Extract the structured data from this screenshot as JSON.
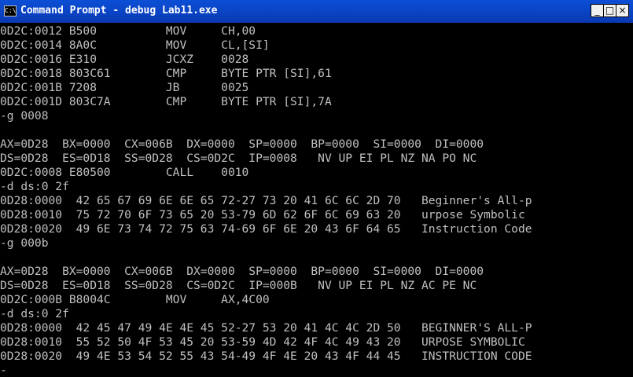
{
  "titlebar": {
    "icon_text": "C:\\",
    "title": "Command Prompt - debug Lab11.exe",
    "minimize_label": "_",
    "maximize_label": "□",
    "close_label": "×"
  },
  "console": {
    "lines": [
      "0D2C:0012 B500          MOV     CH,00",
      "0D2C:0014 8A0C          MOV     CL,[SI]",
      "0D2C:0016 E310          JCXZ    0028",
      "0D2C:0018 803C61        CMP     BYTE PTR [SI],61",
      "0D2C:001B 7208          JB      0025",
      "0D2C:001D 803C7A        CMP     BYTE PTR [SI],7A",
      "-g 0008",
      "",
      "AX=0D28  BX=0000  CX=006B  DX=0000  SP=0000  BP=0000  SI=0000  DI=0000",
      "DS=0D28  ES=0D18  SS=0D28  CS=0D2C  IP=0008   NV UP EI PL NZ NA PO NC",
      "0D2C:0008 E80500        CALL    0010",
      "-d ds:0 2f",
      "0D28:0000  42 65 67 69 6E 6E 65 72-27 73 20 41 6C 6C 2D 70   Beginner's All-p",
      "0D28:0010  75 72 70 6F 73 65 20 53-79 6D 62 6F 6C 69 63 20   urpose Symbolic",
      "0D28:0020  49 6E 73 74 72 75 63 74-69 6F 6E 20 43 6F 64 65   Instruction Code",
      "-g 000b",
      "",
      "AX=0D28  BX=0000  CX=006B  DX=0000  SP=0000  BP=0000  SI=0000  DI=0000",
      "DS=0D28  ES=0D18  SS=0D28  CS=0D2C  IP=000B   NV UP EI PL NZ AC PE NC",
      "0D2C:000B B8004C        MOV     AX,4C00",
      "-d ds:0 2f",
      "0D28:0000  42 45 47 49 4E 4E 45 52-27 53 20 41 4C 4C 2D 50   BEGINNER'S ALL-P",
      "0D28:0010  55 52 50 4F 53 45 20 53-59 4D 42 4F 4C 49 43 20   URPOSE SYMBOLIC",
      "0D28:0020  49 4E 53 54 52 55 43 54-49 4F 4E 20 43 4F 44 45   INSTRUCTION CODE",
      "-"
    ]
  }
}
